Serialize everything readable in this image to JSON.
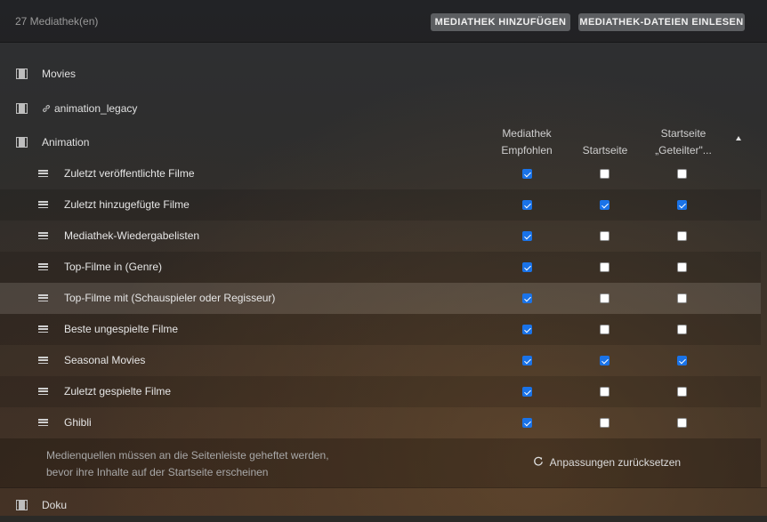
{
  "header": {
    "library_count": "27 Mediathek(en)",
    "add_library_label": "MEDIATHEK HINZUFÜGEN",
    "scan_files_label": "MEDIATHEK-DATEIEN EINLESEN"
  },
  "libraries": [
    {
      "name": "Movies",
      "icon": "film-icon"
    },
    {
      "name": "animation_legacy",
      "icon": "film-icon",
      "linked": true
    },
    {
      "name": "Animation",
      "icon": "film-icon"
    },
    {
      "name": "Doku",
      "icon": "film-icon"
    }
  ],
  "columns": {
    "recommended_line1": "Mediathek",
    "recommended_line2": "Empfohlen",
    "home": "Startseite",
    "shared_line1": "Startseite",
    "shared_line2": "„Geteilter\"..."
  },
  "hubs": [
    {
      "label": "Zuletzt veröffentlichte Filme",
      "recommended": true,
      "home": false,
      "shared": false
    },
    {
      "label": "Zuletzt hinzugefügte Filme",
      "recommended": true,
      "home": true,
      "shared": true
    },
    {
      "label": "Mediathek-Wiedergabelisten",
      "recommended": true,
      "home": false,
      "shared": false
    },
    {
      "label": "Top-Filme in (Genre)",
      "recommended": true,
      "home": false,
      "shared": false
    },
    {
      "label": "Top-Filme mit (Schauspieler oder Regisseur)",
      "recommended": true,
      "home": false,
      "shared": false
    },
    {
      "label": "Beste ungespielte Filme",
      "recommended": true,
      "home": false,
      "shared": false
    },
    {
      "label": "Seasonal Movies",
      "recommended": true,
      "home": true,
      "shared": true
    },
    {
      "label": "Zuletzt gespielte Filme",
      "recommended": true,
      "home": false,
      "shared": false
    },
    {
      "label": "Ghibli",
      "recommended": true,
      "home": false,
      "shared": false
    }
  ],
  "footer": {
    "note_line1": "Medienquellen müssen an die Seitenleiste geheftet werden,",
    "note_line2": "bevor ihre Inhalte auf der Startseite erscheinen",
    "reset_label": "Anpassungen zurücksetzen"
  },
  "colors": {
    "checkbox_checked": "#1a73e8",
    "button_bg": "#5c5e61"
  }
}
